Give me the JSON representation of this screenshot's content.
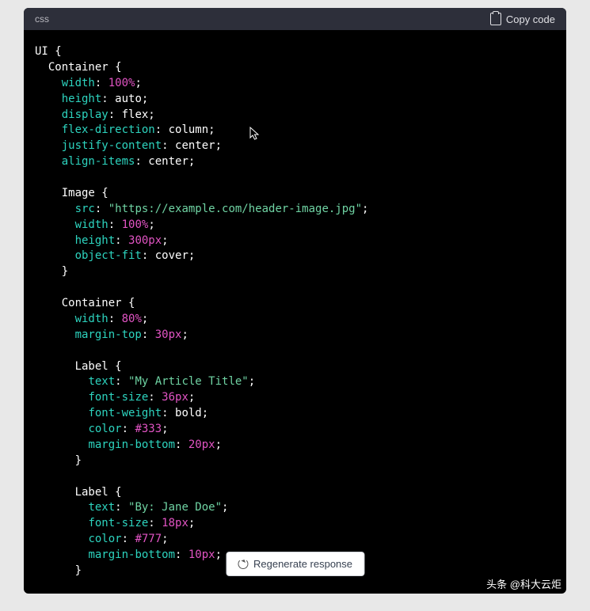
{
  "header": {
    "language": "css",
    "copy_label": "Copy code"
  },
  "code": {
    "line1_a": "UI {",
    "line2_a": "  Container {",
    "line3_a": "    ",
    "line3_b": "width",
    "line3_c": ": ",
    "line3_d": "100%",
    "line3_e": ";",
    "line4_a": "    ",
    "line4_b": "height",
    "line4_c": ": auto;",
    "line5_a": "    ",
    "line5_b": "display",
    "line5_c": ": flex;",
    "line6_a": "    ",
    "line6_b": "flex-direction",
    "line6_c": ": column;",
    "line7_a": "    ",
    "line7_b": "justify-content",
    "line7_c": ": center;",
    "line8_a": "    ",
    "line8_b": "align-items",
    "line8_c": ": center;",
    "line9_a": "",
    "line10_a": "    Image {",
    "line11_a": "      ",
    "line11_b": "src",
    "line11_c": ": ",
    "line11_d": "\"https://example.com/header-image.jpg\"",
    "line11_e": ";",
    "line12_a": "      ",
    "line12_b": "width",
    "line12_c": ": ",
    "line12_d": "100%",
    "line12_e": ";",
    "line13_a": "      ",
    "line13_b": "height",
    "line13_c": ": ",
    "line13_d": "300px",
    "line13_e": ";",
    "line14_a": "      ",
    "line14_b": "object-fit",
    "line14_c": ": cover;",
    "line15_a": "    }",
    "line16_a": "",
    "line17_a": "    Container {",
    "line18_a": "      ",
    "line18_b": "width",
    "line18_c": ": ",
    "line18_d": "80%",
    "line18_e": ";",
    "line19_a": "      ",
    "line19_b": "margin-top",
    "line19_c": ": ",
    "line19_d": "30px",
    "line19_e": ";",
    "line20_a": "",
    "line21_a": "      Label {",
    "line22_a": "        ",
    "line22_b": "text",
    "line22_c": ": ",
    "line22_d": "\"My Article Title\"",
    "line22_e": ";",
    "line23_a": "        ",
    "line23_b": "font-size",
    "line23_c": ": ",
    "line23_d": "36px",
    "line23_e": ";",
    "line24_a": "        ",
    "line24_b": "font-weight",
    "line24_c": ": bold;",
    "line25_a": "        ",
    "line25_b": "color",
    "line25_c": ": ",
    "line25_d": "#333",
    "line25_e": ";",
    "line26_a": "        ",
    "line26_b": "margin-bottom",
    "line26_c": ": ",
    "line26_d": "20px",
    "line26_e": ";",
    "line27_a": "      }",
    "line28_a": "",
    "line29_a": "      Label {",
    "line30_a": "        ",
    "line30_b": "text",
    "line30_c": ": ",
    "line30_d": "\"By: Jane Doe\"",
    "line30_e": ";",
    "line31_a": "        ",
    "line31_b": "font-size",
    "line31_c": ": ",
    "line31_d": "18px",
    "line31_e": ";",
    "line32_a": "        ",
    "line32_b": "color",
    "line32_c": ": ",
    "line32_d": "#777",
    "line32_e": ";",
    "line33_a": "        ",
    "line33_b": "margin-bottom",
    "line33_c": ": ",
    "line33_d": "10px",
    "line33_e": ";",
    "line34_a": "      }"
  },
  "regenerate_label": "Regenerate response",
  "watermark_prefix": "头条 ",
  "watermark_handle": "@科大云炬"
}
